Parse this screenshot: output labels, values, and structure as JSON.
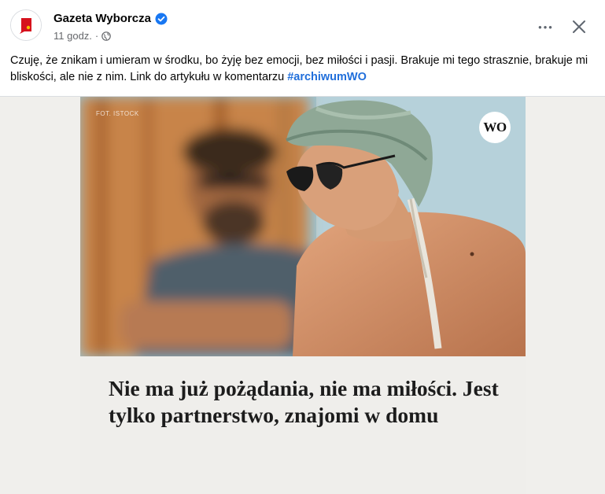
{
  "post": {
    "page_name": "Gazeta Wyborcza",
    "time": "11 godz.",
    "separator": "·",
    "text": "Czuję, że znikam i umieram w środku, bo żyję bez emocji, bez miłości i pasji. Brakuje mi tego strasznie, brakuje mi bliskości, ale nie z nim. Link do artykułu w komentarzu",
    "hashtag": "#archiwumWO"
  },
  "icons": {
    "more": "more-horizontal-icon",
    "close": "close-icon",
    "verified": "verified-badge-icon",
    "audience": "globe-icon"
  },
  "media": {
    "photo_credit": "FOT. ISTOCK",
    "brand_badge": "WO",
    "headline": "Nie ma już pożądania, nie ma miłości. Jest tylko partnerstwo, znajomi w domu"
  },
  "colors": {
    "accent": "#216fdb",
    "verified": "#1877f2",
    "secondary_text": "#65676b",
    "avatar_red": "#d6121d"
  },
  "toolbar": {
    "more_label": "•••"
  }
}
